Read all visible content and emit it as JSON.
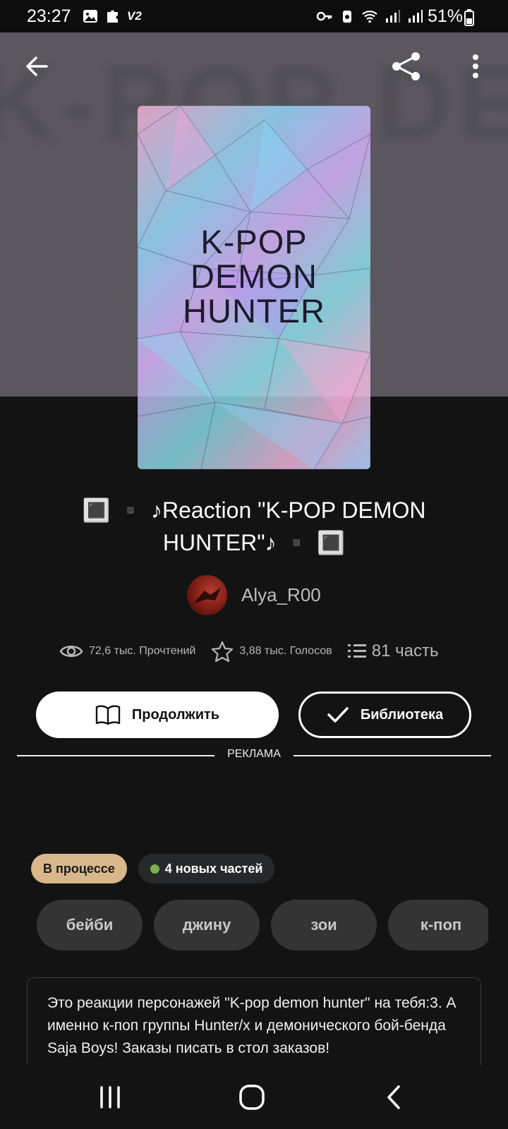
{
  "status_bar": {
    "time": "23:27",
    "v2_label": "V2",
    "battery": "51%",
    "icons": [
      "image-icon",
      "puzzle-icon",
      "key-icon",
      "cleaner-icon",
      "wifi-icon",
      "signal-icon",
      "signal-icon",
      "battery-icon"
    ]
  },
  "header": {
    "background_text": "K-POP DEMON HUNTER"
  },
  "cover": {
    "lines": [
      "K-POP",
      "DEMON",
      "HUNTER"
    ]
  },
  "story": {
    "title": "🔳 ▪️ ♪Reaction \"K-POP DEMON HUNTER\"♪ ▪️ 🔳",
    "author": "Alya_R00"
  },
  "stats": {
    "reads": "72,6 тыс. Прочтений",
    "votes": "3,88 тыс. Голосов",
    "parts": "81 часть"
  },
  "buttons": {
    "continue": "Продолжить",
    "library": "Библиотека"
  },
  "ad_label": "РЕКЛАМА",
  "badges": {
    "status": "В процессе",
    "new_parts": "4 новых частей"
  },
  "tags": [
    "бейби",
    "джину",
    "зои",
    "к-поп"
  ],
  "description": "Это реакции персонажей \"K-pop demon hunter\" на тебя:3. А именно к-поп группы Hunter/x и демонического бой-бенда Saja Boys! Заказы писать в стол заказов!",
  "colors": {
    "background": "#141314",
    "status_badge": "#d8b88a",
    "new_dot": "#7fb04a",
    "tag_bg": "#343435"
  }
}
